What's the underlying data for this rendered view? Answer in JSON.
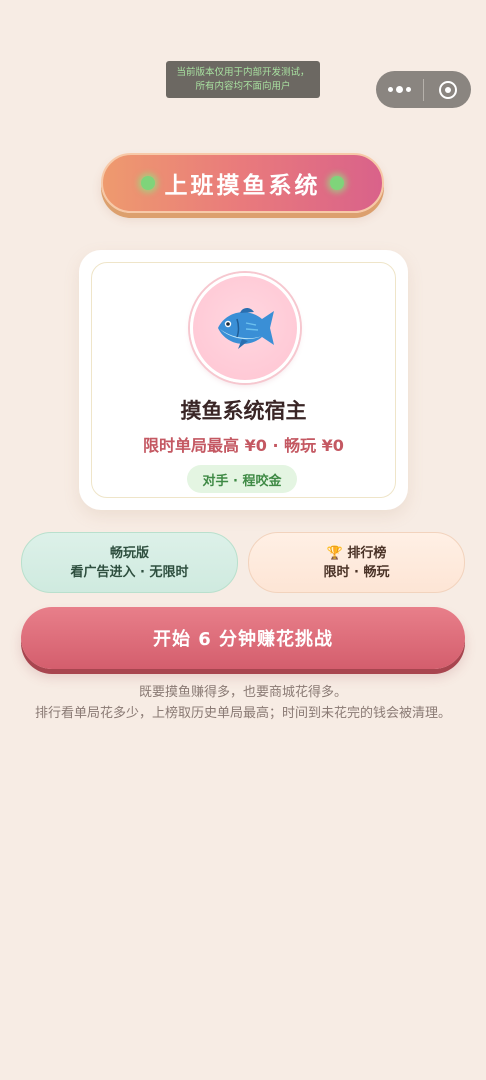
{
  "dev_notice": {
    "line1": "当前版本仅用于内部开发测试，",
    "line2": "所有内容均不面向用户"
  },
  "capsule": {
    "more_icon": "more-dots-icon",
    "close_icon": "target-circle-icon"
  },
  "banner": {
    "title": "上班摸鱼系统"
  },
  "host_card": {
    "avatar_icon": "fish-icon",
    "name": "摸鱼系统宿主",
    "stats": "限时单局最高 ¥0 · 畅玩 ¥0",
    "opponent": "对手 · 程咬金"
  },
  "modes": {
    "casual": {
      "title": "畅玩版",
      "subtitle": "看广告进入 · 无限时"
    },
    "rank": {
      "icon": "🏆",
      "title": "排行榜",
      "subtitle": "限时 · 畅玩"
    }
  },
  "start_button": {
    "label": "开始 6 分钟赚花挑战"
  },
  "description": {
    "line1": "既要摸鱼赚得多，也要商城花得多。",
    "line2": "排行看单局花多少，上榜取历史单局最高；时间到未花完的钱会被清理。"
  },
  "colors": {
    "background": "#f7ece4",
    "accent": "#d45e6d",
    "stats_text": "#c45862",
    "opponent_green": "#3f8a45"
  }
}
